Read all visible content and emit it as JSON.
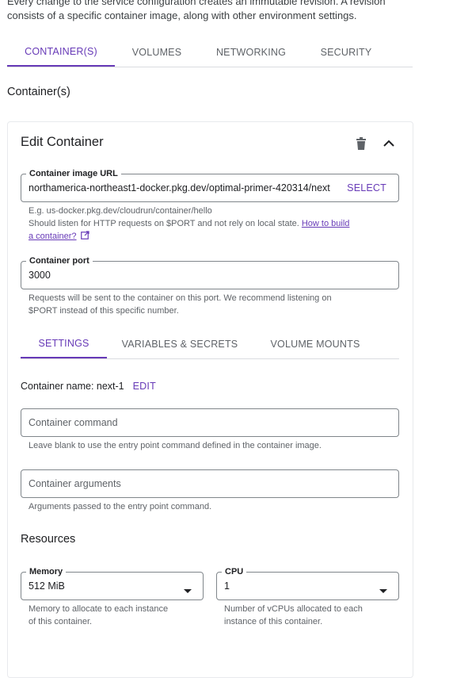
{
  "intro": {
    "line1": "Every change to the service configuration creates an immutable revision. A revision",
    "line2": "consists of a specific container image, along with other environment settings."
  },
  "tabs": [
    {
      "label": "CONTAINER(S)",
      "active": true
    },
    {
      "label": "VOLUMES",
      "active": false
    },
    {
      "label": "NETWORKING",
      "active": false
    },
    {
      "label": "SECURITY",
      "active": false
    }
  ],
  "section_title": "Container(s)",
  "editor": {
    "title": "Edit Container",
    "delete_icon": "trash-icon",
    "collapse_icon": "chevron-up-icon",
    "image": {
      "label": "Container image URL",
      "value": "northamerica-northeast1-docker.pkg.dev/optimal-primer-420314/next",
      "select_label": "SELECT",
      "hint_example": "E.g. us-docker.pkg.dev/cloudrun/container/hello",
      "hint_text": "Should listen for HTTP requests on $PORT and not rely on local state.",
      "hint_link_part1": "How to build",
      "hint_link_part2": "a container?",
      "external_icon": "external-link-icon"
    },
    "port": {
      "label": "Container port",
      "value": "3000",
      "hint_line1": "Requests will be sent to the container on this port. We recommend listening on",
      "hint_line2": "$PORT instead of this specific number."
    },
    "subtabs": [
      {
        "label": "SETTINGS",
        "active": true
      },
      {
        "label": "VARIABLES & SECRETS",
        "active": false
      },
      {
        "label": "VOLUME MOUNTS",
        "active": false
      }
    ],
    "container_name": {
      "text": "Container name: next-1",
      "edit_label": "EDIT"
    },
    "command": {
      "placeholder": "Container command",
      "hint": "Leave blank to use the entry point command defined in the container image."
    },
    "arguments": {
      "placeholder": "Container arguments",
      "hint": "Arguments passed to the entry point command."
    },
    "resources": {
      "title": "Resources",
      "memory": {
        "label": "Memory",
        "value": "512 MiB",
        "hint_line1": "Memory to allocate to each instance",
        "hint_line2": "of this container."
      },
      "cpu": {
        "label": "CPU",
        "value": "1",
        "hint_line1": "Number of vCPUs allocated to each",
        "hint_line2": "instance of this container."
      }
    }
  },
  "colors": {
    "accent": "#673ab7",
    "text": "#202124",
    "muted": "#5f6368",
    "border": "#80868b"
  }
}
